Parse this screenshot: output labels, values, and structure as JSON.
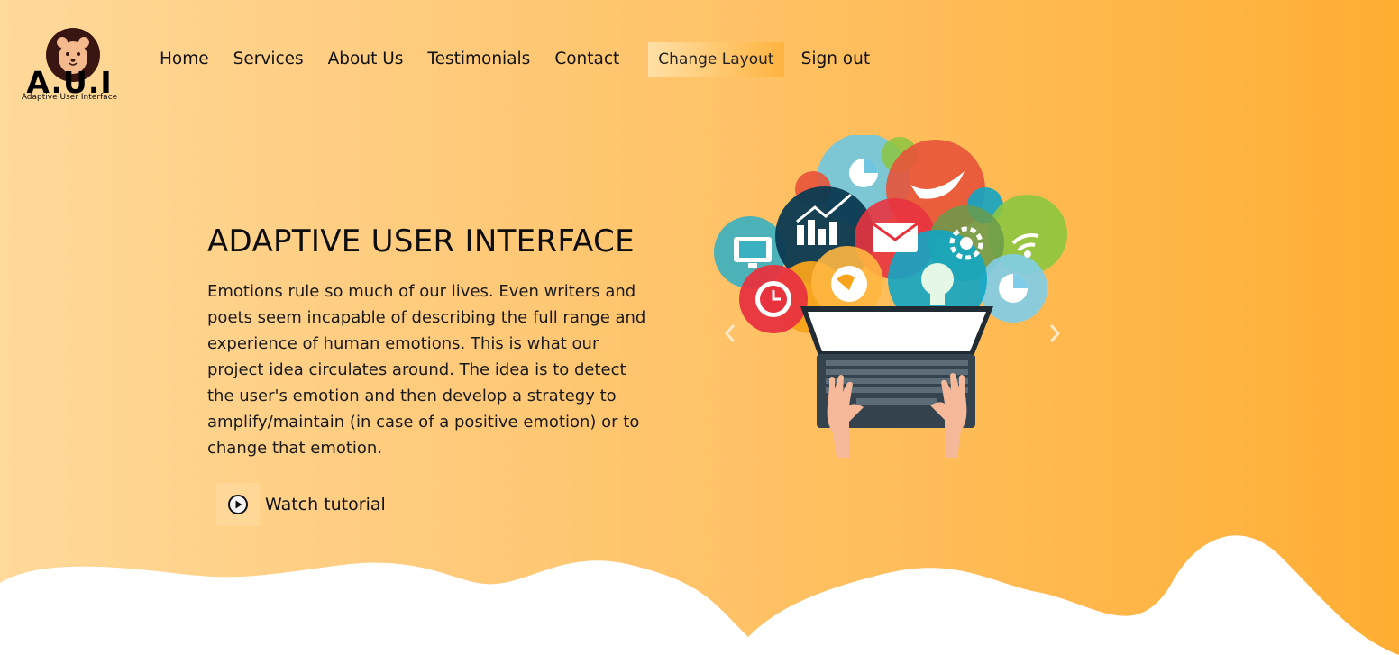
{
  "logo": {
    "title": "A.U.I",
    "tagline": "Adaptive User Interface"
  },
  "nav": {
    "home": "Home",
    "services": "Services",
    "about": "About Us",
    "testimonials": "Testimonials",
    "contact": "Contact",
    "change_layout": "Change Layout",
    "sign_out": "Sign out"
  },
  "hero": {
    "title": "ADAPTIVE USER INTERFACE",
    "description": "Emotions rule so much of our lives. Even writers and poets seem incapable of describing the full range and experience of human emotions. This is what our project idea circulates around. The idea is to detect the user's emotion and then develop a strategy to amplify/maintain (in case of a positive emotion) or to change that emotion.",
    "watch_label": "Watch tutorial"
  },
  "icons": {
    "logo": "bear-face-icon",
    "play": "play-circle-icon",
    "prev": "chevron-left-icon",
    "next": "chevron-right-icon"
  },
  "colors": {
    "gradient_start": "#ffd99a",
    "gradient_end": "#ffae33",
    "button_accent": "#ffb33f",
    "logo_dark": "#3a1612",
    "logo_bear": "#f4b98c"
  }
}
